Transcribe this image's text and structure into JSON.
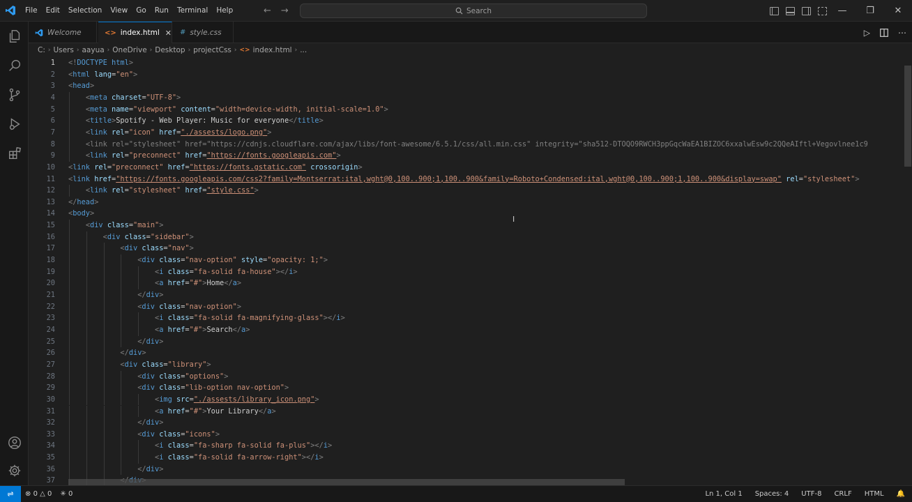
{
  "titlebar": {
    "menu": [
      "File",
      "Edit",
      "Selection",
      "View",
      "Go",
      "Run",
      "Terminal",
      "Help"
    ],
    "search_placeholder": "Search"
  },
  "tabs": [
    {
      "label": "Welcome",
      "icon": "vscode-icon",
      "italic": true
    },
    {
      "label": "index.html",
      "icon": "html-icon",
      "active": true
    },
    {
      "label": "style.css",
      "icon": "css-icon",
      "italic": true
    }
  ],
  "breadcrumb": [
    "C:",
    "Users",
    "aayua",
    "OneDrive",
    "Desktop",
    "projectCss",
    "index.html",
    "..."
  ],
  "editor": {
    "current_line": 1,
    "lines": [
      "<!DOCTYPE html>",
      "<html lang=\"en\">",
      "<head>",
      "    <meta charset=\"UTF-8\">",
      "    <meta name=\"viewport\" content=\"width=device-width, initial-scale=1.0\">",
      "    <title>Spotify - Web Player: Music for everyone</title>",
      "    <link rel=\"icon\" href=\"./assests/logo.png\">",
      "    <link rel=\"stylesheet\" href=\"https://cdnjs.cloudflare.com/ajax/libs/font-awesome/6.5.1/css/all.min.css\" integrity=\"sha512-DTOQO9RWCH3ppGqcWaEA1BIZOC6xxalwEsw9c2QQeAIftl+Vegovlnee1c9",
      "    <link rel=\"preconnect\" href=\"https://fonts.googleapis.com\">",
      "<link rel=\"preconnect\" href=\"https://fonts.gstatic.com\" crossorigin>",
      "<link href=\"https://fonts.googleapis.com/css2?family=Montserrat:ital,wght@0,100..900;1,100..900&family=Roboto+Condensed:ital,wght@0,100..900;1,100..900&display=swap\" rel=\"stylesheet\">",
      "    <link rel=\"stylesheet\" href=\"style.css\">",
      "</head>",
      "<body>",
      "    <div class=\"main\">",
      "        <div class=\"sidebar\">",
      "            <div class=\"nav\">",
      "                <div class=\"nav-option\" style=\"opacity: 1;\">",
      "                    <i class=\"fa-solid fa-house\"></i>",
      "                    <a href=\"#\">Home</a>",
      "                </div>",
      "                <div class=\"nav-option\">",
      "                    <i class=\"fa-solid fa-magnifying-glass\"></i>",
      "                    <a href=\"#\">Search</a>",
      "                </div>",
      "            </div>",
      "            <div class=\"library\">",
      "                <div class=\"options\">",
      "                <div class=\"lib-option nav-option\">",
      "                    <img src=\"./assests/library_icon.png\">",
      "                    <a href=\"#\">Your Library</a>",
      "                </div>",
      "                <div class=\"icons\">",
      "                    <i class=\"fa-sharp fa-solid fa-plus\"></i>",
      "                    <i class=\"fa-solid fa-arrow-right\"></i>",
      "                </div>",
      "            </div>"
    ]
  },
  "statusbar": {
    "errors": "0",
    "warnings": "0",
    "ports": "0",
    "position": "Ln 1, Col 1",
    "spaces": "Spaces: 4",
    "encoding": "UTF-8",
    "eol": "CRLF",
    "language": "HTML"
  },
  "colors": {
    "accent": "#0078d4",
    "tag": "#569cd6",
    "attribute": "#9cdcfe",
    "string": "#ce9178"
  }
}
